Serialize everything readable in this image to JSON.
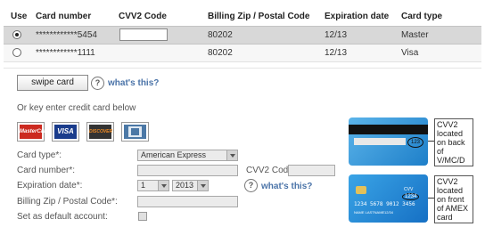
{
  "table": {
    "headers": {
      "use": "Use",
      "card_number": "Card number",
      "cvv2": "CVV2 Code",
      "zip": "Billing Zip / Postal Code",
      "exp": "Expiration date",
      "type": "Card type"
    },
    "rows": [
      {
        "selected": true,
        "card_number": "************5454",
        "zip": "80202",
        "exp": "12/13",
        "type": "Master"
      },
      {
        "selected": false,
        "card_number": "************1111",
        "zip": "80202",
        "exp": "12/13",
        "type": "Visa"
      }
    ]
  },
  "swipe": {
    "button": "swipe card",
    "help_icon": "?",
    "help_link": "what's this?"
  },
  "manual_heading": "Or key enter credit card below",
  "logos": [
    {
      "name": "MasterCard",
      "text": "MasterCard",
      "color": "#cc2a20"
    },
    {
      "name": "VISA",
      "text": "VISA",
      "color": "#1a3c8c"
    },
    {
      "name": "DISCOVER",
      "text": "DISCOVER",
      "color": "#333333"
    },
    {
      "name": "AMEX",
      "text": "",
      "color": "#4b78a6"
    }
  ],
  "form": {
    "card_type_label": "Card type*:",
    "card_type_value": "American Express",
    "card_number_label": "Card number*:",
    "cvv_label": "CVV2 Code:",
    "exp_label": "Expiration date*:",
    "exp_month": "1",
    "exp_year": "2013",
    "help_icon": "?",
    "help_link": "what's this?",
    "zip_label": "Billing Zip / Postal Code*:",
    "default_label": "Set as default account:"
  },
  "cvv_help": {
    "back": {
      "lines": [
        "CVV2",
        "located",
        "on back",
        "of",
        "V/MC/D"
      ],
      "card_digits": "123"
    },
    "front": {
      "lines": [
        "CVV2",
        "located",
        "on front",
        "of AMEX",
        "card"
      ],
      "card_number": "1234 5678 9012 3456",
      "card_cvv": "1234",
      "card_name": "NAME LASTNAME",
      "card_exp": "12/34",
      "card_mark": "CVV"
    }
  },
  "colors": {
    "selected_row": "#d8d8d8",
    "link": "#4a73a8",
    "card_blue": "#2c8fd6"
  }
}
